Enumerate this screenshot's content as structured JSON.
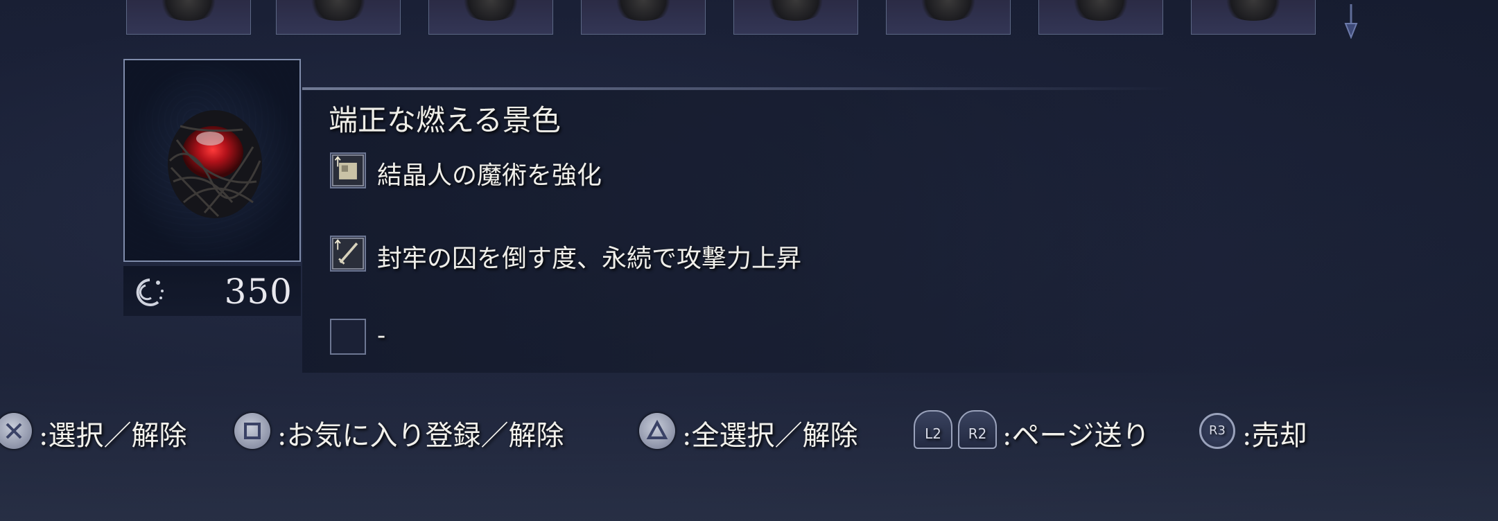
{
  "item": {
    "name": "端正な燃える景色",
    "price": "350",
    "effects": [
      {
        "icon": "spell-boost-icon",
        "text": "結晶人の魔術を強化"
      },
      {
        "icon": "sword-boost-icon",
        "text": "封牢の囚を倒す度、永続で攻撃力上昇"
      },
      {
        "icon": "empty-slot-icon",
        "text": "-"
      }
    ]
  },
  "controls": {
    "cross_label": ":選択／解除",
    "square_label": ":お気に入り登録／解除",
    "triangle_label": ":全選択／解除",
    "l2_label": "L2",
    "r2_label": "R2",
    "page_label": ":ページ送り",
    "r3_label": "R3",
    "sell_label": ":売却"
  },
  "colors": {
    "background": "#1a2036",
    "frame_border": "#7f8cab",
    "text": "#efeee8",
    "item_red": "#b3121a"
  }
}
